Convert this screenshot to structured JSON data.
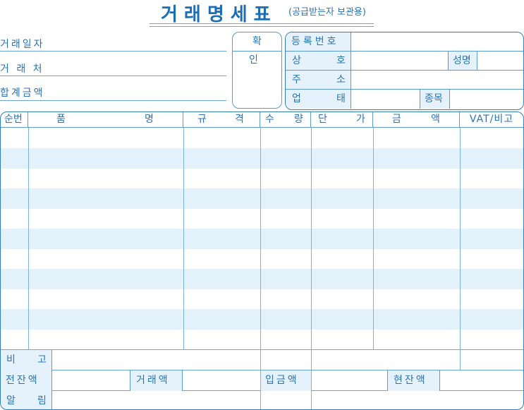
{
  "header": {
    "title": "거래명세표",
    "subtitle": "(공급받는자 보관용)"
  },
  "left_fields": {
    "date_label": "거래일자",
    "client_label": "거 래 처",
    "total_label": "합계금액"
  },
  "confirm": {
    "label": "확 인"
  },
  "supplier": {
    "reg_no_label": "등록번호",
    "company_label_a": "상",
    "company_label_b": "호",
    "name_label": "성명",
    "address_label_a": "주",
    "address_label_b": "소",
    "business_label_a": "업",
    "business_label_b": "태",
    "item_type_label": "종목"
  },
  "table": {
    "columns": {
      "seq": "순번",
      "item_a": "품",
      "item_b": "명",
      "spec_a": "규",
      "spec_b": "격",
      "qty_a": "수",
      "qty_b": "량",
      "price_a": "단",
      "price_b": "가",
      "amount_a": "금",
      "amount_b": "액",
      "vat": "VAT/비고"
    },
    "row_count": 11
  },
  "footer": {
    "remarks_a": "비",
    "remarks_b": "고",
    "prev_balance": "전잔액",
    "trade_amount": "거래액",
    "deposit": "입금액",
    "current_balance": "현잔액",
    "notice_a": "알",
    "notice_b": "림"
  },
  "colors": {
    "primary": "#1d6db5",
    "line": "#5b9bd0",
    "stripe": "#e3f1fb"
  }
}
